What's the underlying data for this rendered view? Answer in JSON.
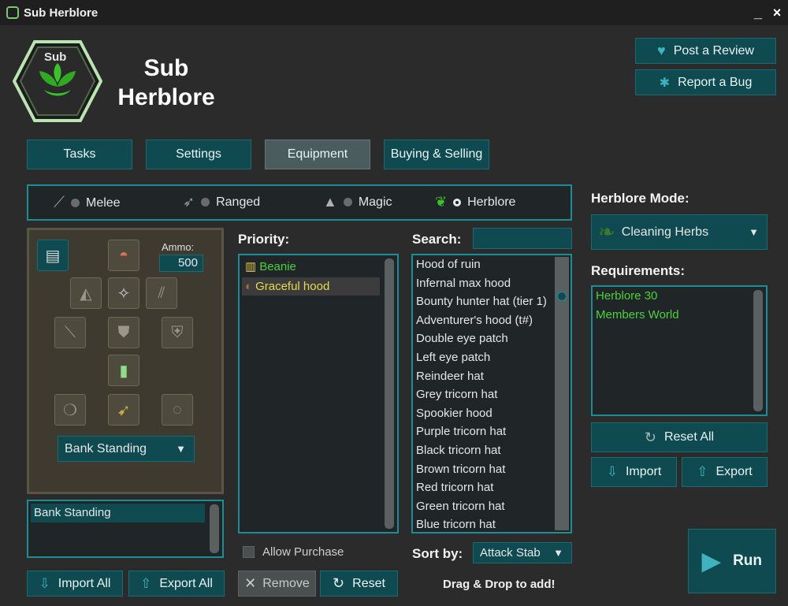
{
  "window": {
    "title": "Sub Herblore",
    "minimize": "_",
    "close": "×"
  },
  "logo": {
    "badge_text": "Sub",
    "title_line1": "Sub",
    "title_line2": "Herblore"
  },
  "header_buttons": {
    "review": "Post a Review",
    "bug": "Report a Bug"
  },
  "tabs": [
    {
      "label": "Tasks"
    },
    {
      "label": "Settings"
    },
    {
      "label": "Equipment"
    },
    {
      "label": "Buying & Selling"
    }
  ],
  "combat_styles": [
    {
      "label": "Melee",
      "selected": false
    },
    {
      "label": "Ranged",
      "selected": false
    },
    {
      "label": "Magic",
      "selected": false
    },
    {
      "label": "Herblore",
      "selected": true
    }
  ],
  "equipment": {
    "ammo_label": "Ammo:",
    "ammo_value": "500",
    "preset_dropdown": "Bank Standing",
    "preset_list": [
      "Bank Standing"
    ]
  },
  "priority": {
    "label": "Priority:",
    "items": [
      "Beanie",
      "Graceful hood"
    ],
    "allow_purchase": "Allow Purchase",
    "remove": "Remove",
    "reset": "Reset"
  },
  "search": {
    "label": "Search:",
    "value": "",
    "items": [
      "Hood of ruin",
      "Infernal max hood",
      "Bounty hunter hat (tier 1)",
      "Adventurer's hood (t#)",
      "Double eye patch",
      "Left eye patch",
      "Reindeer hat",
      "Grey tricorn hat",
      "Spookier hood",
      "Purple tricorn hat",
      "Black tricorn hat",
      "Brown tricorn hat",
      "Red tricorn hat",
      "Green tricorn hat",
      "Blue tricorn hat"
    ],
    "sort_label": "Sort by:",
    "sort_value": "Attack Stab",
    "hint": "Drag & Drop to add!"
  },
  "herblore": {
    "mode_label": "Herblore Mode:",
    "mode_value": "Cleaning Herbs",
    "req_label": "Requirements:",
    "requirements": [
      "Herblore 30",
      "Members World"
    ],
    "reset_all": "Reset All",
    "import": "Import",
    "export": "Export"
  },
  "footer": {
    "import_all": "Import All",
    "export_all": "Export All",
    "run": "Run"
  },
  "colors": {
    "accent": "#1a8d97",
    "button": "#0f4a50",
    "green_text": "#4cd13a",
    "yellow_text": "#e8d84a"
  }
}
